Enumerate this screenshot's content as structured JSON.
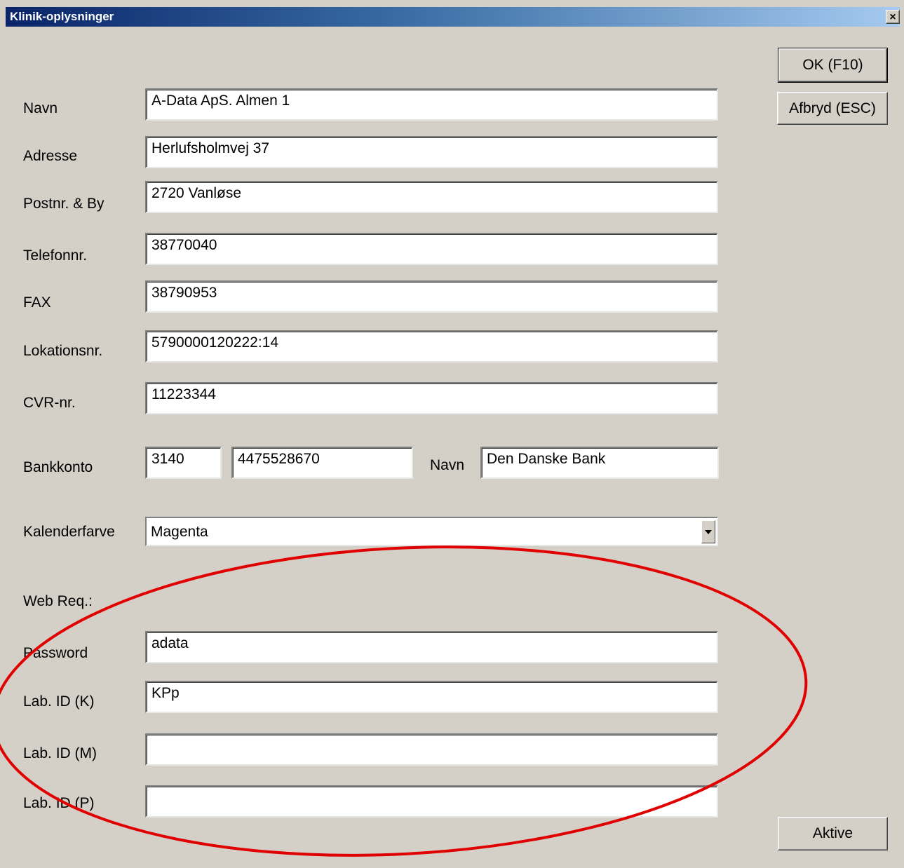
{
  "window": {
    "title": "Klinik-oplysninger",
    "close_label": "×"
  },
  "buttons": {
    "ok": "OK (F10)",
    "cancel": "Afbryd (ESC)",
    "active": "Aktive"
  },
  "form": {
    "navn": {
      "label": "Navn",
      "value": "A-Data ApS. Almen 1"
    },
    "adresse": {
      "label": "Adresse",
      "value": "Herlufsholmvej 37"
    },
    "postnr": {
      "label": "Postnr. & By",
      "value": "2720 Vanløse"
    },
    "telefon": {
      "label": "Telefonnr.",
      "value": "38770040"
    },
    "fax": {
      "label": "FAX",
      "value": "38790953"
    },
    "lokation": {
      "label": "Lokationsnr.",
      "value": "5790000120222:14"
    },
    "cvr": {
      "label": "CVR-nr.",
      "value": "11223344"
    },
    "bank": {
      "label": "Bankkonto",
      "reg": "3140",
      "account": "4475528670",
      "name_label": "Navn",
      "name_value": "Den Danske Bank"
    },
    "kalender": {
      "label": "Kalenderfarve",
      "value": "Magenta"
    },
    "web_heading": "Web Req.:",
    "password": {
      "label": "Password",
      "value": "adata"
    },
    "lab_k": {
      "label": "Lab. ID (K)",
      "value": "KPp"
    },
    "lab_m": {
      "label": "Lab. ID (M)",
      "value": ""
    },
    "lab_p": {
      "label": "Lab. ID (P)",
      "value": ""
    }
  },
  "annotation": {
    "color": "#e00000"
  }
}
